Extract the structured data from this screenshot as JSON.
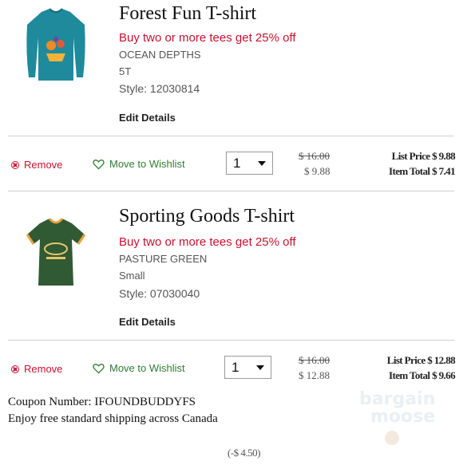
{
  "items": [
    {
      "title": "Forest Fun T-shirt",
      "promo": "Buy two or more tees get 25% off",
      "color": "OCEAN DEPTHS",
      "size": "5T",
      "style": "Style: 12030814",
      "edit": "Edit Details",
      "remove": "Remove",
      "wishlist": "Move to Wishlist",
      "qty": "1",
      "old_price": "$ 16.00",
      "new_price": "$ 9.88",
      "list_price": "List Price $ 9.88",
      "item_total": "Item Total $ 7.41",
      "shirt_color": "#1f8a9c",
      "thumb_icon": "teal-long-sleeve-tshirt"
    },
    {
      "title": "Sporting Goods T-shirt",
      "promo": "Buy two or more tees get 25% off",
      "color": "PASTURE GREEN",
      "size": "Small",
      "style": "Style: 07030040",
      "edit": "Edit Details",
      "remove": "Remove",
      "wishlist": "Move to Wishlist",
      "qty": "1",
      "old_price": "$ 16.00",
      "new_price": "$ 12.88",
      "list_price": "List Price $ 12.88",
      "item_total": "Item Total $ 9.66",
      "shirt_color": "#2f5a34",
      "thumb_icon": "green-ringer-tshirt"
    }
  ],
  "coupon": "Coupon Number: IFOUNDBUDDYFS",
  "shipping": "Enjoy free standard shipping across Canada",
  "discount": "(-$ 4.50)",
  "watermark": {
    "line1": "bargain",
    "line2": "moose"
  },
  "colors": {
    "promo_red": "#c8102e",
    "wishlist_green": "#2e7d32",
    "divider": "#cfcfcf"
  }
}
